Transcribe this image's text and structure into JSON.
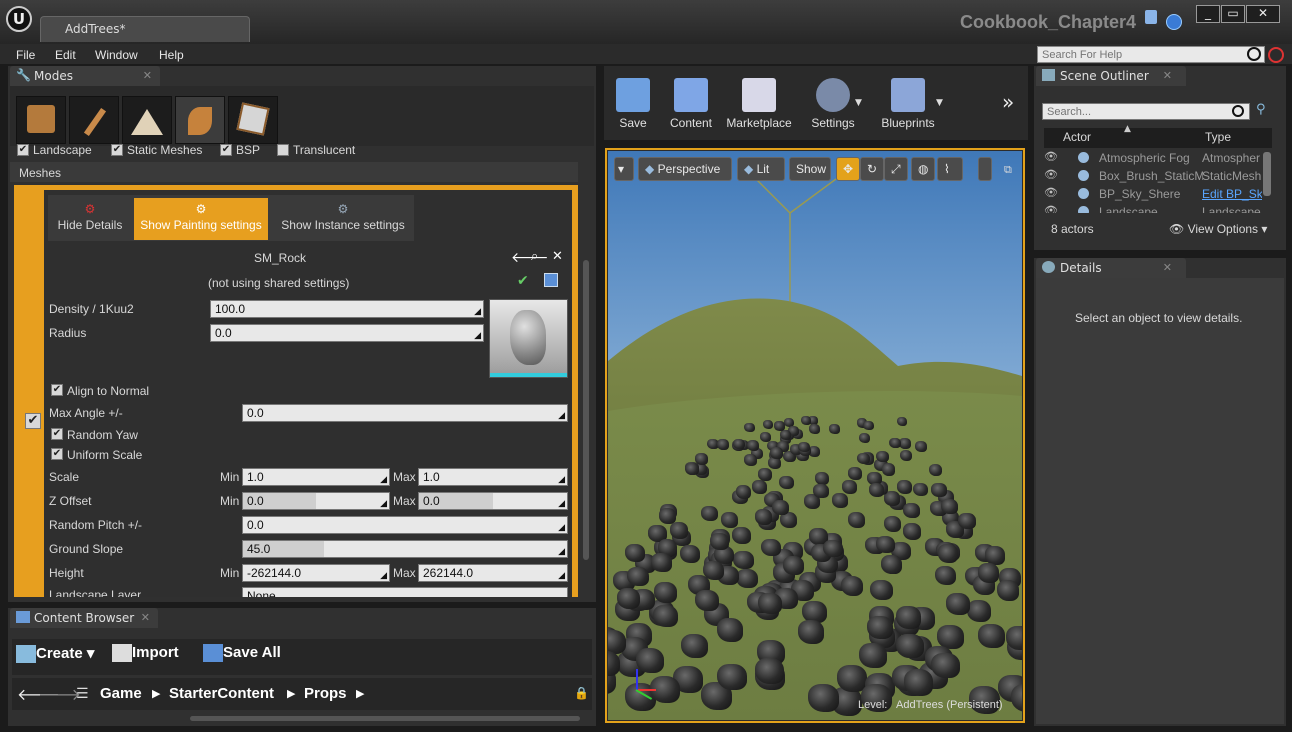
{
  "window": {
    "tab_title": "AddTrees*",
    "project": "Cookbook_Chapter4"
  },
  "menu": [
    "File",
    "Edit",
    "Window",
    "Help"
  ],
  "help_search": {
    "placeholder": "Search For Help"
  },
  "modes": {
    "tab": "Modes",
    "filters": [
      "Landscape",
      "Static Meshes",
      "BSP",
      "Translucent"
    ],
    "meshes_header": "Meshes",
    "toolbar": {
      "hide": "Hide Details",
      "paint": "Show Painting settings",
      "instance": "Show Instance settings"
    },
    "mesh_name": "SM_Rock",
    "shared": "(not using shared settings)",
    "density_label": "Density / 1Kuu2",
    "density_value": "100.0",
    "radius_label": "Radius",
    "radius_value": "0.0",
    "align_label": "Align to Normal",
    "max_angle_label": "Max Angle +/-",
    "max_angle_value": "0.0",
    "random_yaw_label": "Random Yaw",
    "uniform_scale_label": "Uniform Scale",
    "scale_label": "Scale",
    "scale_min": "1.0",
    "scale_max": "1.0",
    "zoffset_label": "Z Offset",
    "zoffset_min": "0.0",
    "zoffset_max": "0.0",
    "random_pitch_label": "Random Pitch +/-",
    "random_pitch_value": "0.0",
    "ground_slope_label": "Ground Slope",
    "ground_slope_value": "45.0",
    "height_label": "Height",
    "height_min": "-262144.0",
    "height_max": "262144.0",
    "landscape_layer_label": "Landscape Layer",
    "landscape_layer_value": "None",
    "min_label": "Min",
    "max_label": "Max"
  },
  "toolbar": [
    "Save",
    "Content",
    "Marketplace",
    "Settings",
    "Blueprints"
  ],
  "viewport": {
    "perspective": "Perspective",
    "lit": "Lit",
    "show": "Show",
    "level_label": "Level:",
    "level_name": "AddTrees (Persistent)"
  },
  "outliner": {
    "tab": "Scene Outliner",
    "search_placeholder": "Search...",
    "col_actor": "Actor",
    "col_type": "Type",
    "rows": [
      {
        "name": "Atmospheric Fog",
        "type": "Atmospher"
      },
      {
        "name": "Box_Brush_StaticM",
        "type": "StaticMesh"
      },
      {
        "name": "BP_Sky_Shere",
        "type": "Edit BP_Sk"
      },
      {
        "name": "Landscape",
        "type": "Landscape"
      }
    ],
    "count": "8 actors",
    "view_options": "View Options"
  },
  "details": {
    "tab": "Details",
    "empty": "Select an object to view details."
  },
  "content_browser": {
    "tab": "Content Browser",
    "create": "Create",
    "import": "Import",
    "save_all": "Save All",
    "path": [
      "Game",
      "StarterContent",
      "Props"
    ]
  }
}
